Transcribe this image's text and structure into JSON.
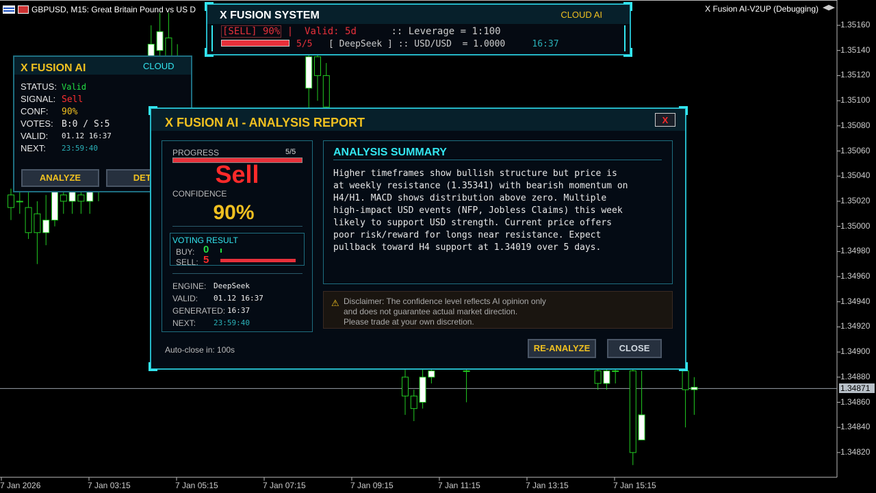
{
  "chart_title": {
    "symbol_text": "GBPUSD, M15:  Great Britain Pound vs US D",
    "ea_label": "X Fusion AI-V2UP (Debugging)"
  },
  "price_axis": [
    "1.35160",
    "1.35140",
    "1.35120",
    "1.35100",
    "1.35080",
    "1.35060",
    "1.35040",
    "1.35020",
    "1.35000",
    "1.34980",
    "1.34960",
    "1.34940",
    "1.34920",
    "1.34900",
    "1.34880",
    "1.34860",
    "1.34840",
    "1.34820"
  ],
  "current_price": "1.34871",
  "time_axis": [
    "7 Jan 2026",
    "7 Jan 03:15",
    "7 Jan 05:15",
    "7 Jan 07:15",
    "7 Jan 09:15",
    "7 Jan 11:15",
    "7 Jan 13:15",
    "7 Jan 15:15"
  ],
  "system_panel": {
    "title": "X FUSION SYSTEM",
    "cloud": "CLOUD AI",
    "signal": "[SELL] 90%",
    "divider": "|",
    "valid": "Valid: 5d",
    "leverage": ":: Leverage = 1:100",
    "progress": "5/5",
    "engine": "[ DeepSeek ]",
    "rate": ":: USD/USD  = 1.0000",
    "time": "16:37"
  },
  "small_panel": {
    "title": "X FUSION AI",
    "cloud": "CLOUD",
    "rows": [
      {
        "label": "STATUS:",
        "value": "Valid"
      },
      {
        "label": "SIGNAL:",
        "value": "Sell"
      },
      {
        "label": "CONF:",
        "value": "90%"
      },
      {
        "label": "VOTES:",
        "value": "B:0 / S:5"
      },
      {
        "label": "VALID:",
        "value": "01.12 16:37"
      },
      {
        "label": "NEXT:",
        "value": "23:59:40"
      }
    ],
    "analyze_label": "ANALYZE",
    "details_label": "DETA"
  },
  "report": {
    "title": "X FUSION AI - ANALYSIS REPORT",
    "close_x": "X",
    "progress_label": "PROGRESS",
    "progress_value": "5/5",
    "progress_fraction": 1.0,
    "signal": "Sell",
    "confidence_label": "CONFIDENCE",
    "confidence_value": "90%",
    "voting_title": "VOTING RESULT",
    "buy_label": "BUY:",
    "buy_value": "0",
    "sell_label": "SELL:",
    "sell_value": "5",
    "engine_label": "ENGINE:",
    "engine_value": "DeepSeek",
    "valid_label": "VALID:",
    "valid_value": "01.12 16:37",
    "generated_label": "GENERATED:",
    "generated_value": "16:37",
    "next_label": "NEXT:",
    "next_value": "23:59:40",
    "summary_title": "ANALYSIS SUMMARY",
    "summary_lines": [
      "Higher timeframes show bullish structure but price is",
      "at weekly resistance (1.35341) with bearish momentum on",
      "H4/H1. MACD shows distribution above zero. Multiple",
      "high-impact USD events (NFP, Jobless Claims) this week",
      "likely to support USD strength. Current price offers",
      "poor risk/reward for longs near resistance. Expect",
      "pullback toward H4 support at 1.34019 over 5 days."
    ],
    "disclaimer_lines": [
      "Disclaimer: The confidence level reflects AI opinion only",
      "and does not guarantee actual market direction.",
      "Please trade at your own discretion."
    ],
    "autoclose": "Auto-close in: 100s",
    "reanalyze_label": "RE-ANALYZE",
    "close_label": "CLOSE"
  },
  "colors": {
    "accent": "#33e6f0",
    "gold": "#f0c020",
    "sell": "#e8303a",
    "buy": "#22dd44",
    "bull_candle": "#ffffff",
    "wick": "#22cc22"
  },
  "chart_data": {
    "type": "candlestick",
    "ylim": [
      1.3481,
      1.3517
    ],
    "current_price": 1.34871,
    "candles": [
      {
        "x": 0,
        "o": 1.35025,
        "c": 1.35015,
        "h": 1.3503,
        "l": 1.35005
      },
      {
        "x": 1,
        "o": 1.3502,
        "c": 1.3502,
        "h": 1.3503,
        "l": 1.3501
      },
      {
        "x": 2,
        "o": 1.35015,
        "c": 1.34995,
        "h": 1.3503,
        "l": 1.3499
      },
      {
        "x": 3,
        "o": 1.3501,
        "c": 1.34995,
        "h": 1.3502,
        "l": 1.3497
      },
      {
        "x": 4,
        "o": 1.34995,
        "c": 1.35005,
        "h": 1.35025,
        "l": 1.34985
      },
      {
        "x": 5,
        "o": 1.35005,
        "c": 1.3503,
        "h": 1.3504,
        "l": 1.35
      },
      {
        "x": 6,
        "o": 1.35025,
        "c": 1.3502,
        "h": 1.3503,
        "l": 1.3501
      },
      {
        "x": 7,
        "o": 1.3502,
        "c": 1.3503,
        "h": 1.3504,
        "l": 1.3501
      },
      {
        "x": 8,
        "o": 1.35025,
        "c": 1.3502,
        "h": 1.3503,
        "l": 1.3501
      },
      {
        "x": 9,
        "o": 1.3502,
        "c": 1.3503,
        "h": 1.3504,
        "l": 1.3501
      },
      {
        "x": 10,
        "o": 1.3503,
        "c": 1.35035,
        "h": 1.35045,
        "l": 1.3502
      },
      {
        "x": 16,
        "o": 1.3513,
        "c": 1.35145,
        "h": 1.3516,
        "l": 1.3512
      },
      {
        "x": 17,
        "o": 1.3514,
        "c": 1.35155,
        "h": 1.3517,
        "l": 1.3513
      },
      {
        "x": 18,
        "o": 1.3515,
        "c": 1.35135,
        "h": 1.3517,
        "l": 1.3512
      },
      {
        "x": 19,
        "o": 1.35135,
        "c": 1.3511,
        "h": 1.35145,
        "l": 1.3509
      },
      {
        "x": 34,
        "o": 1.3511,
        "c": 1.35135,
        "h": 1.35145,
        "l": 1.3509
      },
      {
        "x": 35,
        "o": 1.35135,
        "c": 1.3512,
        "h": 1.3515,
        "l": 1.351
      },
      {
        "x": 36,
        "o": 1.3512,
        "c": 1.35095,
        "h": 1.3513,
        "l": 1.3509
      },
      {
        "x": 45,
        "o": 1.3488,
        "c": 1.34865,
        "h": 1.3489,
        "l": 1.3485
      },
      {
        "x": 46,
        "o": 1.34865,
        "c": 1.34855,
        "h": 1.3487,
        "l": 1.34845
      },
      {
        "x": 47,
        "o": 1.3486,
        "c": 1.3488,
        "h": 1.3489,
        "l": 1.34855
      },
      {
        "x": 48,
        "o": 1.3488,
        "c": 1.34885,
        "h": 1.3489,
        "l": 1.34875
      },
      {
        "x": 52,
        "o": 1.34885,
        "c": 1.34885,
        "h": 1.3489,
        "l": 1.3486
      },
      {
        "x": 67,
        "o": 1.34885,
        "c": 1.34875,
        "h": 1.3489,
        "l": 1.3487
      },
      {
        "x": 68,
        "o": 1.34875,
        "c": 1.34885,
        "h": 1.3489,
        "l": 1.3487
      },
      {
        "x": 69,
        "o": 1.34885,
        "c": 1.34885,
        "h": 1.3489,
        "l": 1.34875
      },
      {
        "x": 71,
        "o": 1.34885,
        "c": 1.3482,
        "h": 1.3489,
        "l": 1.3481
      },
      {
        "x": 72,
        "o": 1.3483,
        "c": 1.3485,
        "h": 1.34885,
        "l": 1.3484
      },
      {
        "x": 77,
        "o": 1.34885,
        "c": 1.3487,
        "h": 1.3489,
        "l": 1.3484
      },
      {
        "x": 78,
        "o": 1.3487,
        "c": 1.34872,
        "h": 1.3488,
        "l": 1.3485
      }
    ]
  }
}
